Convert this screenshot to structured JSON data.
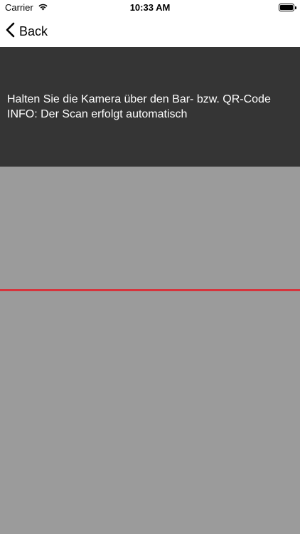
{
  "status_bar": {
    "carrier": "Carrier",
    "time": "10:33 AM",
    "wifi_icon": "wifi-icon",
    "battery_icon": "battery-icon",
    "battery_level": 1.0
  },
  "nav": {
    "back_label": "Back",
    "back_icon": "chevron-left-icon"
  },
  "instructions": {
    "line1": "Halten Sie die Kamera über den Bar- bzw. QR-Code",
    "line2": "INFO: Der Scan erfolgt automatisch"
  },
  "colors": {
    "panel_bg": "#353535",
    "camera_bg": "#9b9b9b",
    "scan_line": "#d6343c"
  }
}
